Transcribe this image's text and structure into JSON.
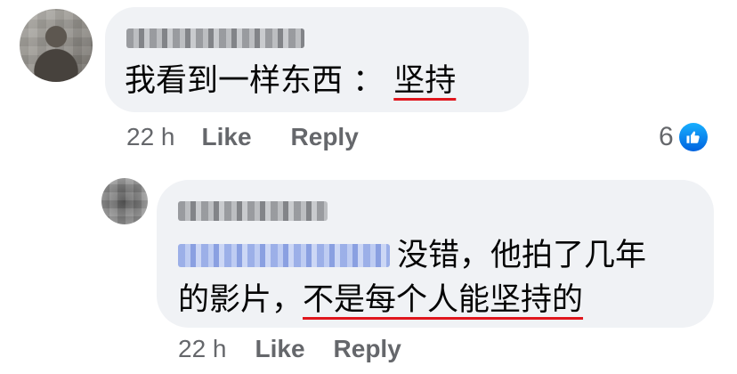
{
  "comments": [
    {
      "text": "我看到一样东西 ：",
      "highlight": "坚持",
      "time": "22 h",
      "like_label": "Like",
      "reply_label": "Reply",
      "reaction_count": "6",
      "reaction_icon": "like-icon"
    },
    {
      "line1_text": "没错，他拍了几年",
      "line2_prefix": "的影片，",
      "line2_highlight": "不是每个人能坚持的",
      "time": "22 h",
      "like_label": "Like",
      "reply_label": "Reply"
    }
  ],
  "colors": {
    "bubble": "#f0f2f5",
    "text": "#050505",
    "meta": "#65676b",
    "underline": "#e0161d",
    "like_blue": "#1877f2"
  }
}
